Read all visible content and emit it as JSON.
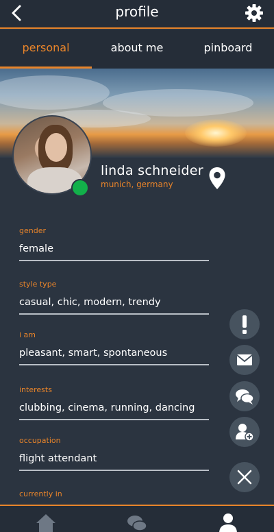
{
  "header": {
    "title": "profile",
    "back_icon": "chevron-left-icon",
    "settings_icon": "gear-icon"
  },
  "tabs": [
    {
      "label": "personal",
      "active": true
    },
    {
      "label": "about me",
      "active": false
    },
    {
      "label": "pinboard",
      "active": false
    }
  ],
  "profile": {
    "name": "linda schneider",
    "location": "munich, germany",
    "status": "online",
    "status_color": "#12b04a",
    "location_icon": "map-pin-icon"
  },
  "fields": [
    {
      "label": "gender",
      "value": "female"
    },
    {
      "label": "style type",
      "value": "casual, chic, modern, trendy"
    },
    {
      "label": "i am",
      "value": "pleasant, smart, spontaneous"
    },
    {
      "label": "interests",
      "value": "clubbing, cinema, running, dancing"
    },
    {
      "label": "occupation",
      "value": "flight attendant"
    },
    {
      "label": "currently in",
      "value": ""
    }
  ],
  "actions": [
    {
      "name": "report",
      "icon": "exclamation-icon"
    },
    {
      "name": "message",
      "icon": "envelope-icon"
    },
    {
      "name": "chat",
      "icon": "chat-bubbles-icon"
    },
    {
      "name": "add-contact",
      "icon": "add-user-icon"
    },
    {
      "name": "close",
      "icon": "close-icon"
    }
  ],
  "bottom_nav": [
    {
      "name": "home",
      "icon": "home-icon",
      "active": false
    },
    {
      "name": "chat",
      "icon": "chat-icon",
      "active": false
    },
    {
      "name": "profile",
      "icon": "user-icon",
      "active": true
    }
  ],
  "colors": {
    "accent": "#e8842a",
    "background": "#2b3440",
    "bar": "#252d38",
    "fab": "#47535f"
  }
}
